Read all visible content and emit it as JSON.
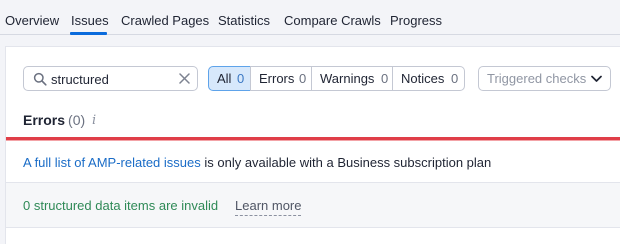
{
  "tabs": [
    {
      "label": "Overview"
    },
    {
      "label": "Issues",
      "active": true
    },
    {
      "label": "Crawled Pages"
    },
    {
      "label": "Statistics"
    },
    {
      "label": "Compare Crawls"
    },
    {
      "label": "Progress"
    }
  ],
  "search": {
    "value": "structured",
    "icon": "search-icon",
    "clear_icon": "close-icon"
  },
  "filters": {
    "all": {
      "label": "All",
      "count": "0",
      "selected": true
    },
    "errors": {
      "label": "Errors",
      "count": "0"
    },
    "warnings": {
      "label": "Warnings",
      "count": "0"
    },
    "notices": {
      "label": "Notices",
      "count": "0"
    }
  },
  "triggered_checks": {
    "placeholder": "Triggered checks",
    "icon": "chevron-down-icon"
  },
  "section": {
    "title": "Errors",
    "count": "(0)",
    "info_icon": "i"
  },
  "amp_notice": {
    "link_text": "A full list of AMP-related issues",
    "text": " is only available with a Business subscription plan"
  },
  "summary": {
    "text": "0 structured data items are invalid",
    "learn_more": "Learn more"
  },
  "colors": {
    "accent": "#0a6bdc",
    "error_rule": "#e03e48",
    "success_text": "#2f8a57",
    "link": "#1a6cc7"
  }
}
